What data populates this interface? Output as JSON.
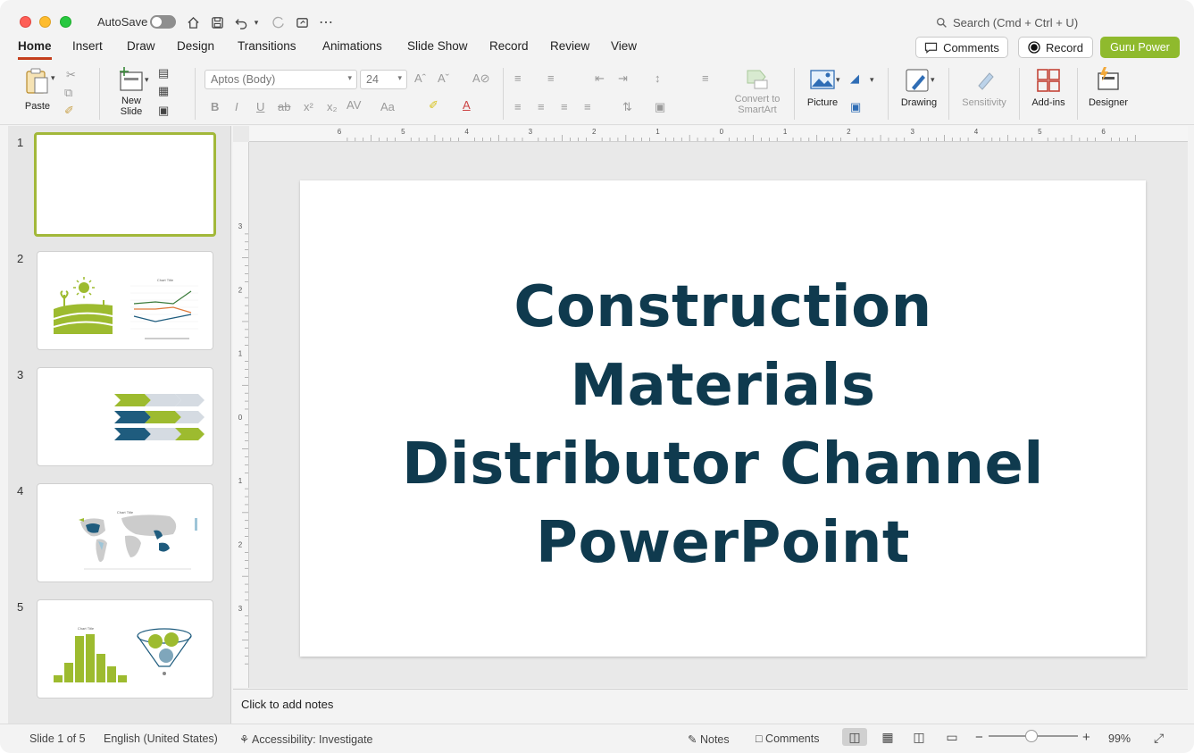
{
  "titlebar": {
    "autosave_label": "AutoSave",
    "search_placeholder": "Search (Cmd + Ctrl + U)"
  },
  "tabs": [
    "Home",
    "Insert",
    "Draw",
    "Design",
    "Transitions",
    "Animations",
    "Slide Show",
    "Record",
    "Review",
    "View"
  ],
  "header_buttons": {
    "comments": "Comments",
    "record": "Record",
    "guru": "Guru Power"
  },
  "ribbon": {
    "paste": "Paste",
    "new_slide_1": "New",
    "new_slide_2": "Slide",
    "font_name": "Aptos (Body)",
    "font_size": "24",
    "convert_1": "Convert to",
    "convert_2": "SmartArt",
    "picture": "Picture",
    "drawing": "Drawing",
    "sensitivity": "Sensitivity",
    "addins": "Add-ins",
    "designer": "Designer"
  },
  "thumbnails": [
    {
      "num": "1"
    },
    {
      "num": "2"
    },
    {
      "num": "3"
    },
    {
      "num": "4"
    },
    {
      "num": "5"
    }
  ],
  "slide": {
    "title_lines": [
      "Construction",
      "Materials",
      "Distributor Channel",
      "PowerPoint"
    ]
  },
  "ruler": {
    "h_labels": [
      "6",
      "5",
      "4",
      "3",
      "2",
      "1",
      "0",
      "1",
      "2",
      "3",
      "4",
      "5",
      "6"
    ],
    "v_labels": [
      "3",
      "2",
      "1",
      "0",
      "1",
      "2",
      "3"
    ]
  },
  "notes_placeholder": "Click to add notes",
  "status": {
    "slide_of": "Slide 1 of 5",
    "language": "English (United States)",
    "accessibility": "Accessibility: Investigate",
    "notes": "Notes",
    "comments": "Comments",
    "zoom": "99%"
  },
  "colors": {
    "accent": "#c43e1c",
    "guru": "#8fba2d",
    "title": "#0f3a4e",
    "thumb_green": "#9dbb2f",
    "thumb_blue": "#1f5c7e"
  }
}
